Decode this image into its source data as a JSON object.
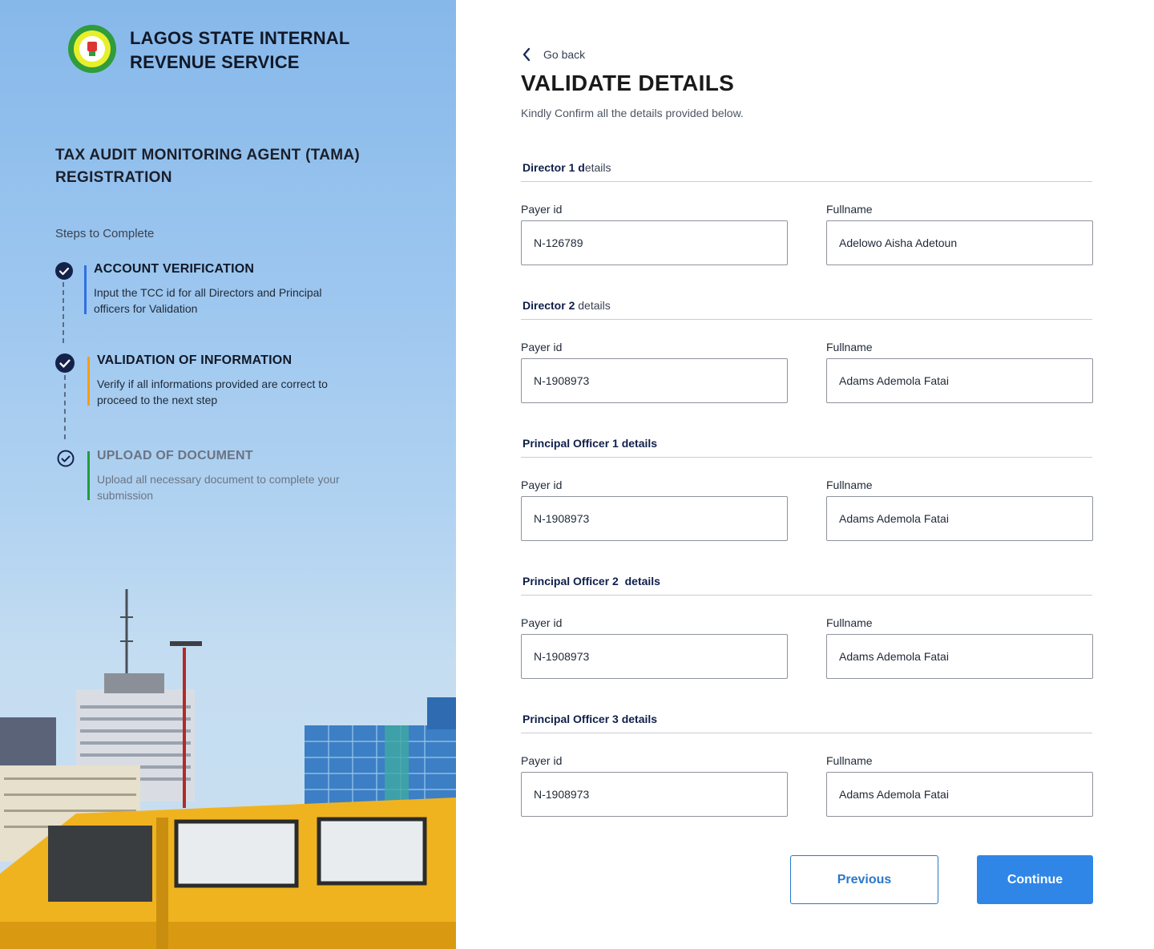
{
  "brand": {
    "title": "LAGOS STATE INTERNAL REVENUE SERVICE"
  },
  "registration": {
    "title": "TAX AUDIT MONITORING AGENT (TAMA) REGISTRATION",
    "steps_label": "Steps to Complete"
  },
  "steps": [
    {
      "title": "ACCOUNT VERIFICATION",
      "desc": "Input the TCC id for all Directors and Principal officers for Validation",
      "status": "completed",
      "accent": "#2f6fe0"
    },
    {
      "title": "VALIDATION OF INFORMATION",
      "desc": "Verify if all informations provided are correct to proceed to the next step",
      "status": "completed",
      "accent": "#f59e0b"
    },
    {
      "title": "UPLOAD OF DOCUMENT",
      "desc": "Upload all necessary document to complete your submission",
      "status": "pending",
      "accent": "#1f9d3a"
    }
  ],
  "nav": {
    "back_label": "Go back"
  },
  "page": {
    "title": "VALIDATE DETAILS",
    "subtitle": "Kindly Confirm all the details provided below."
  },
  "sections": [
    {
      "head_bold": "Director 1 d",
      "head_rest": "etails",
      "payer_label": "Payer id",
      "payer_id": "N-126789",
      "name_label": "Fullname",
      "fullname": "Adelowo Aisha Adetoun"
    },
    {
      "head_bold": "Director 2",
      "head_rest": " details",
      "payer_label": "Payer id",
      "payer_id": "N-1908973",
      "name_label": "Fullname",
      "fullname": "Adams Ademola Fatai"
    },
    {
      "head_bold": "Principal Officer 1 details",
      "head_rest": "",
      "payer_label": "Payer id",
      "payer_id": "N-1908973",
      "name_label": "Fullname",
      "fullname": "Adams Ademola Fatai"
    },
    {
      "head_bold": "Principal Officer 2  details",
      "head_rest": "",
      "payer_label": "Payer id",
      "payer_id": "N-1908973",
      "name_label": "Fullname",
      "fullname": "Adams Ademola Fatai"
    },
    {
      "head_bold": "Principal Officer 3 details",
      "head_rest": "",
      "payer_label": "Payer id",
      "payer_id": "N-1908973",
      "name_label": "Fullname",
      "fullname": "Adams Ademola Fatai"
    }
  ],
  "actions": {
    "previous_label": "Previous",
    "continue_label": "Continue"
  },
  "colors": {
    "primary": "#2f86e6",
    "heading_navy": "#0f1f4a"
  }
}
